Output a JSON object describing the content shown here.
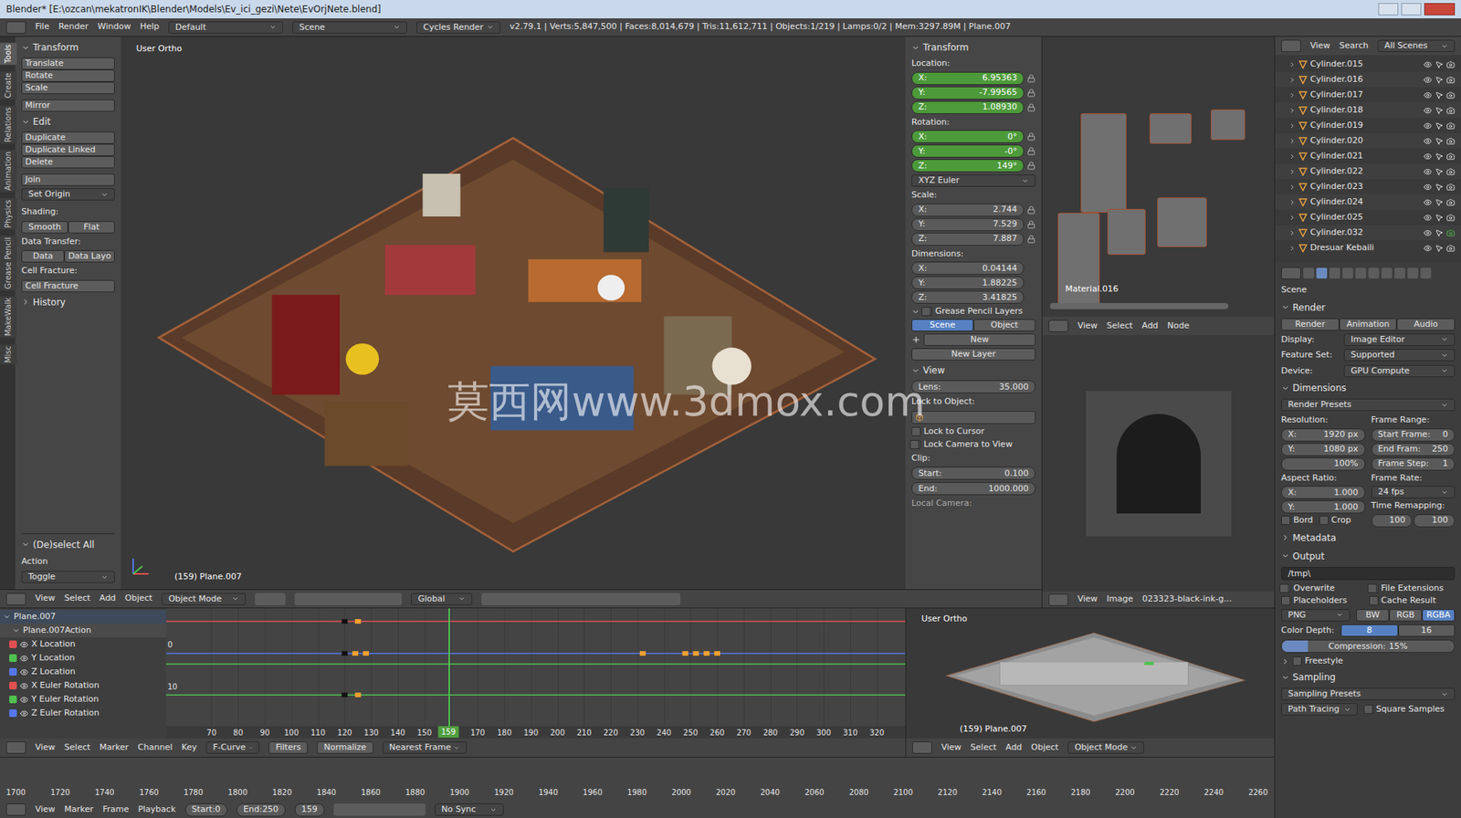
{
  "window": {
    "title": "Blender* [E:\\ozcan\\mekatronIK\\Blender\\Models\\Ev_ici_gezi\\Nete\\EvOrjNete.blend]"
  },
  "info_header": {
    "menus": [
      "File",
      "Render",
      "Window",
      "Help"
    ],
    "layout": "Default",
    "scene": "Scene",
    "engine": "Cycles Render",
    "stats": "v2.79.1 | Verts:5,847,500 | Faces:8,014,679 | Tris:11,612,711 | Objects:1/219 | Lamps:0/2 | Mem:3297.89M | Plane.007"
  },
  "tool_tabs": [
    {
      "label": "Tools",
      "selected": true
    },
    {
      "label": "Create",
      "selected": false
    },
    {
      "label": "Relations",
      "selected": false
    },
    {
      "label": "Animation",
      "selected": false
    },
    {
      "label": "Physics",
      "selected": false
    },
    {
      "label": "Grease Pencil",
      "selected": false
    },
    {
      "label": "MakeWalk",
      "selected": false
    },
    {
      "label": "Misc",
      "selected": false
    }
  ],
  "tool_shelf": {
    "transform": {
      "title": "Transform",
      "buttons": [
        "Translate",
        "Rotate",
        "Scale"
      ],
      "mirror": "Mirror"
    },
    "edit": {
      "title": "Edit",
      "buttons": [
        "Duplicate",
        "Duplicate Linked",
        "Delete"
      ],
      "join": "Join",
      "set_origin": "Set Origin"
    },
    "shading": {
      "label": "Shading:",
      "buttons": [
        "Smooth",
        "Flat"
      ]
    },
    "data_transfer": {
      "label": "Data Transfer:",
      "buttons": [
        "Data",
        "Data Layo"
      ]
    },
    "cell_fracture": {
      "label": "Cell Fracture:",
      "button": "Cell Fracture"
    },
    "history": {
      "title": "History",
      "expanded": false
    }
  },
  "operator_panel": {
    "title": "(De)select All",
    "label": "Action",
    "value": "Toggle"
  },
  "viewport": {
    "view_name": "User Ortho",
    "object_label": "(159) Plane.007",
    "watermark": "莫西网www.3dmox.com"
  },
  "n_panel": {
    "transform_title": "Transform",
    "location": {
      "label": "Location:",
      "fields": [
        {
          "axis": "X:",
          "value": "6.95363",
          "animated": true
        },
        {
          "axis": "Y:",
          "value": "-7.99565",
          "animated": true
        },
        {
          "axis": "Z:",
          "value": "1.08930",
          "animated": true
        }
      ]
    },
    "rotation": {
      "label": "Rotation:",
      "fields": [
        {
          "axis": "X:",
          "value": "0°",
          "animated": true
        },
        {
          "axis": "Y:",
          "value": "-0°",
          "animated": true
        },
        {
          "axis": "Z:",
          "value": "149°",
          "animated": true
        }
      ]
    },
    "rotation_mode": "XYZ Euler",
    "scale": {
      "label": "Scale:",
      "fields": [
        {
          "axis": "X:",
          "value": "2.744",
          "animated": false
        },
        {
          "axis": "Y:",
          "value": "7.529",
          "animated": false
        },
        {
          "axis": "Z:",
          "value": "7.887",
          "animated": false
        }
      ]
    },
    "dimensions": {
      "label": "Dimensions:",
      "fields": [
        {
          "axis": "X:",
          "value": "0.04144",
          "animated": false
        },
        {
          "axis": "Y:",
          "value": "1.88225",
          "animated": false
        },
        {
          "axis": "Z:",
          "value": "3.41825",
          "animated": false
        }
      ]
    },
    "grease_pencil": {
      "title": "Grease Pencil Layers",
      "checked": true,
      "tabs": [
        {
          "label": "Scene",
          "selected": true
        },
        {
          "label": "Object",
          "selected": false
        }
      ],
      "new": "New",
      "new_layer": "New Layer"
    },
    "view": {
      "title": "View",
      "lens_label": "Lens:",
      "lens": "35.000",
      "lock_to_object": "Lock to Object:",
      "lock_to_cursor": {
        "label": "Lock to Cursor",
        "checked": false
      },
      "lock_camera": {
        "label": "Lock Camera to View",
        "checked": true
      },
      "clip": "Clip:",
      "clip_start": {
        "label": "Start:",
        "value": "0.100"
      },
      "clip_end": {
        "label": "End:",
        "value": "1000.000"
      },
      "local_camera": "Local Camera:"
    }
  },
  "node_editor": {
    "material": "Material.016",
    "menus": [
      "View",
      "Select",
      "Add",
      "Node"
    ]
  },
  "image_editor": {
    "menus": [
      "View",
      "Image"
    ],
    "image_name": "023323-black-ink-g..."
  },
  "outliner": {
    "menus": [
      "View",
      "Search"
    ],
    "scenes": "All Scenes",
    "items": [
      {
        "name": "Cylinder.015",
        "selected": false
      },
      {
        "name": "Cylinder.016",
        "selected": false
      },
      {
        "name": "Cylinder.017",
        "selected": false
      },
      {
        "name": "Cylinder.018",
        "selected": false
      },
      {
        "name": "Cylinder.019",
        "selected": false
      },
      {
        "name": "Cylinder.020",
        "selected": false
      },
      {
        "name": "Cylinder.021",
        "selected": false
      },
      {
        "name": "Cylinder.022",
        "selected": false
      },
      {
        "name": "Cylinder.023",
        "selected": false
      },
      {
        "name": "Cylinder.024",
        "selected": false
      },
      {
        "name": "Cylinder.025",
        "selected": false
      },
      {
        "name": "Cylinder.032",
        "selected": true
      },
      {
        "name": "Dresuar Kebaili",
        "selected": false
      }
    ]
  },
  "properties": {
    "context": "Scene",
    "render": {
      "title": "Render",
      "buttons": [
        "Render",
        "Animation",
        "Audio"
      ],
      "rows": [
        {
          "label": "Display:",
          "value": "Image Editor"
        },
        {
          "label": "Feature Set:",
          "value": "Supported"
        },
        {
          "label": "Device:",
          "value": "GPU Compute"
        }
      ]
    },
    "dimensions": {
      "title": "Dimensions",
      "presets": "Render Presets",
      "resolution": "Resolution:",
      "res_x": {
        "label": "X:",
        "value": "1920 px"
      },
      "res_y": {
        "label": "Y:",
        "value": "1080 px"
      },
      "res_pct": "100%",
      "frame_range": "Frame Range:",
      "start": {
        "label": "Start Frame:",
        "value": "0"
      },
      "end": {
        "label": "End Fram:",
        "value": "250"
      },
      "step": {
        "label": "Frame Step:",
        "value": "1"
      },
      "aspect": "Aspect Ratio:",
      "asp_x": {
        "label": "X:",
        "value": "1.000"
      },
      "asp_y": {
        "label": "Y:",
        "value": "1.000"
      },
      "frame_rate": "Frame Rate:",
      "fps": "24 fps",
      "time_remap": "Time Remapping:",
      "remap_old": "100",
      "remap_new": "100",
      "bord": {
        "label": "Bord",
        "checked": false
      },
      "crop": {
        "label": "Crop",
        "checked": false
      }
    },
    "metadata": {
      "title": "Metadata",
      "expanded": false
    },
    "output": {
      "title": "Output",
      "path": "/tmp\\",
      "checks": [
        {
          "label": "Overwrite",
          "checked": true
        },
        {
          "label": "File Extensions",
          "checked": true
        },
        {
          "label": "Placeholders",
          "checked": false
        },
        {
          "label": "Cache Result",
          "checked": false
        }
      ],
      "format": "PNG",
      "modes": [
        {
          "label": "BW",
          "selected": false
        },
        {
          "label": "RGB",
          "selected": false
        },
        {
          "label": "RGBA",
          "selected": true
        }
      ],
      "depth_label": "Color Depth:",
      "depths": [
        {
          "label": "8",
          "selected": true
        },
        {
          "label": "16",
          "selected": false
        }
      ],
      "compression": "Compression:",
      "compression_value": "15%",
      "compression_level": 0.15
    },
    "freestyle": {
      "title": "Freestyle",
      "checked": false
    },
    "sampling": {
      "title": "Sampling",
      "presets": "Sampling Presets",
      "mode": "Path Tracing",
      "square": {
        "label": "Square Samples",
        "checked": false
      }
    }
  },
  "view3d_header": {
    "menus": [
      "View",
      "Select",
      "Add",
      "Object"
    ],
    "mode": "Object Mode",
    "orientation": "Global"
  },
  "graph_editor": {
    "channels": [
      {
        "name": "Plane.007",
        "kind": "object",
        "color": "#9a9a9a"
      },
      {
        "name": "Plane.007Action",
        "kind": "action",
        "color": "#9a9a9a"
      },
      {
        "name": "X Location",
        "kind": "curve",
        "color": "#e05050"
      },
      {
        "name": "Y Location",
        "kind": "curve",
        "color": "#4fc04f"
      },
      {
        "name": "Z Location",
        "kind": "curve",
        "color": "#5577e8"
      },
      {
        "name": "X Euler Rotation",
        "kind": "curve",
        "color": "#e05050"
      },
      {
        "name": "Y Euler Rotation",
        "kind": "curve",
        "color": "#4fc04f"
      },
      {
        "name": "Z Euler Rotation",
        "kind": "curve",
        "color": "#5577e8"
      }
    ],
    "curves": [
      {
        "color": "#e05050",
        "level": 0.89,
        "keys": [
          120,
          125
        ]
      },
      {
        "color": "#5577e8",
        "level": 0.62,
        "keys": [
          120,
          124,
          128,
          232,
          248,
          252,
          256,
          260
        ]
      },
      {
        "color": "#4fc04f",
        "level": 0.53,
        "keys": []
      },
      {
        "color": "#4fc04f",
        "level": 0.27,
        "keys": [
          120,
          125
        ]
      }
    ],
    "selected_key": 120,
    "frame_ticks": [
      "70",
      "80",
      "90",
      "100",
      "110",
      "120",
      "130",
      "140",
      "150",
      "160",
      "170",
      "180",
      "190",
      "200",
      "210",
      "220",
      "230",
      "240",
      "250",
      "260",
      "270",
      "280",
      "290",
      "300",
      "310",
      "320"
    ],
    "value_ticks": [
      "0",
      "10"
    ],
    "current_frame": "159",
    "header": {
      "menus": [
        "View",
        "Select",
        "Marker",
        "Channel",
        "Key"
      ],
      "mode": "F-Curve",
      "filters": "Filters",
      "normalize": "Normalize",
      "snap": "Nearest Frame"
    }
  },
  "small_view": {
    "view_name": "User Ortho",
    "object_label": "(159) Plane.007",
    "menus": [
      "View",
      "Select",
      "Add",
      "Object"
    ],
    "mode": "Object Mode"
  },
  "timeline": {
    "ticks": [
      "1700",
      "1720",
      "1740",
      "1760",
      "1780",
      "1800",
      "1820",
      "1840",
      "1860",
      "1880",
      "1900",
      "1920",
      "1940",
      "1960",
      "1980",
      "2000",
      "2020",
      "2040",
      "2060",
      "2080",
      "2100",
      "2120",
      "2140",
      "2160",
      "2180",
      "2200",
      "2220",
      "2240",
      "2260"
    ],
    "menus": [
      "View",
      "Marker",
      "Frame",
      "Playback"
    ],
    "start_label": "Start:",
    "start": "0",
    "end_label": "End:",
    "end": "250",
    "frame": "159",
    "sync": "No Sync"
  }
}
